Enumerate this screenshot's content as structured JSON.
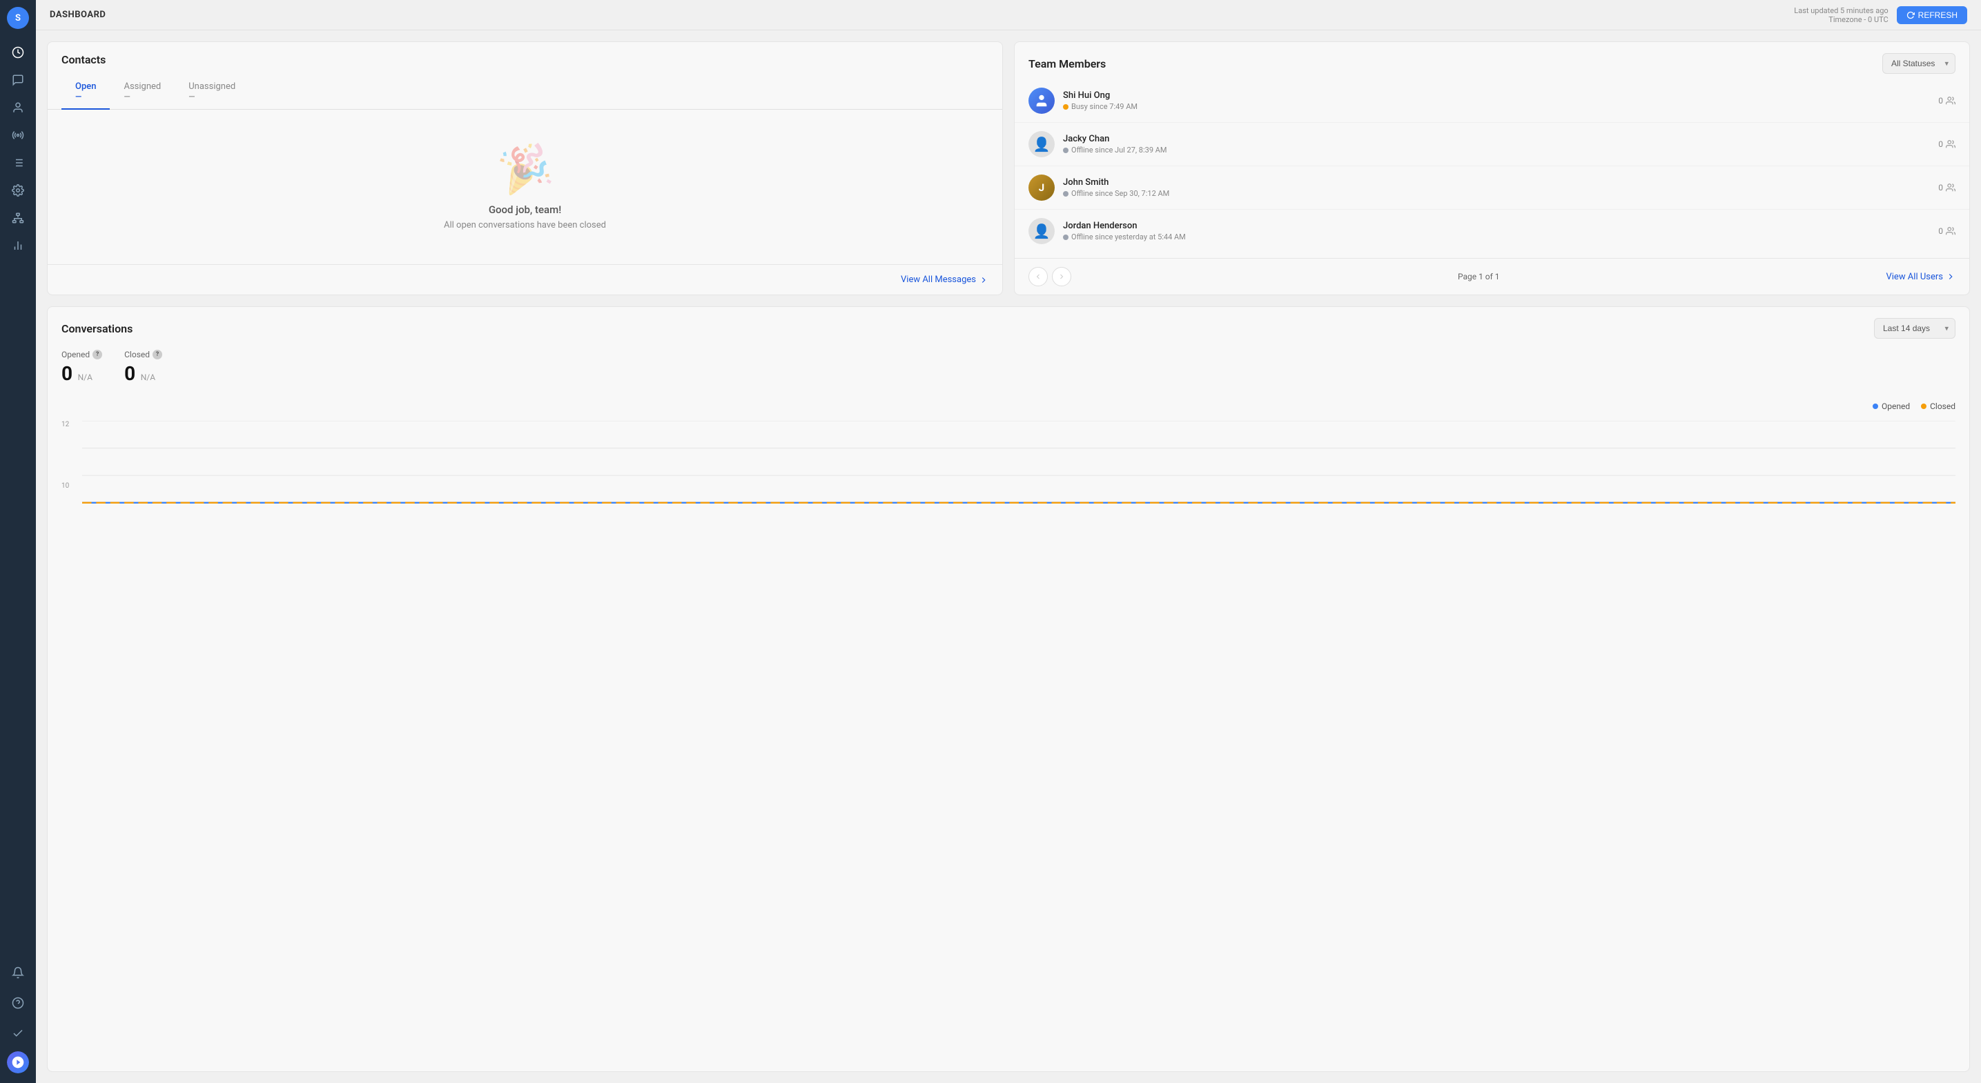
{
  "app": {
    "title": "DASHBOARD"
  },
  "topbar": {
    "last_updated": "Last updated 5 minutes ago",
    "timezone": "Timezone - 0 UTC",
    "refresh_label": "REFRESH"
  },
  "sidebar": {
    "user_initial": "S",
    "icons": [
      {
        "name": "home-icon",
        "glyph": "⟳"
      },
      {
        "name": "chat-icon",
        "glyph": "💬"
      },
      {
        "name": "contacts-icon",
        "glyph": "👤"
      },
      {
        "name": "broadcast-icon",
        "glyph": "📡"
      },
      {
        "name": "reports-icon",
        "glyph": "☰"
      },
      {
        "name": "settings-icon",
        "glyph": "⚙"
      },
      {
        "name": "team-icon",
        "glyph": "🏢"
      },
      {
        "name": "analytics-icon",
        "glyph": "📊"
      },
      {
        "name": "more-settings-icon",
        "glyph": "⚙"
      }
    ]
  },
  "contacts": {
    "title": "Contacts",
    "tabs": [
      {
        "label": "Open",
        "count": "—",
        "active": true
      },
      {
        "label": "Assigned",
        "count": "—",
        "active": false
      },
      {
        "label": "Unassigned",
        "count": "—",
        "active": false
      }
    ],
    "empty_title": "Good job, team!",
    "empty_subtitle": "All open conversations have been closed",
    "view_all_label": "View All Messages"
  },
  "team_members": {
    "title": "Team Members",
    "status_filter_label": "All Statuses",
    "members": [
      {
        "name": "Shi Hui Ong",
        "status": "Busy since 7:49 AM",
        "status_type": "busy",
        "count": "0",
        "avatar_type": "blue"
      },
      {
        "name": "Jacky Chan",
        "status": "Offline since Jul 27, 8:39 AM",
        "status_type": "offline",
        "count": "0",
        "avatar_type": "silhouette"
      },
      {
        "name": "John Smith",
        "status": "Offline since Sep 30, 7:12 AM",
        "status_type": "offline",
        "count": "0",
        "avatar_type": "photo"
      },
      {
        "name": "Jordan Henderson",
        "status": "Offline since yesterday at 5:44 AM",
        "status_type": "offline",
        "count": "0",
        "avatar_type": "silhouette"
      }
    ],
    "pagination": {
      "page_info": "Page 1 of 1"
    },
    "view_all_label": "View All Users"
  },
  "conversations": {
    "title": "Conversations",
    "time_filter_label": "Last 14 days",
    "stats": {
      "opened_label": "Opened",
      "closed_label": "Closed",
      "opened_value": "0",
      "closed_value": "0",
      "opened_na": "N/A",
      "closed_na": "N/A"
    },
    "chart": {
      "y_labels": [
        "12",
        "10"
      ],
      "legend": {
        "opened_label": "Opened",
        "closed_label": "Closed"
      }
    }
  }
}
